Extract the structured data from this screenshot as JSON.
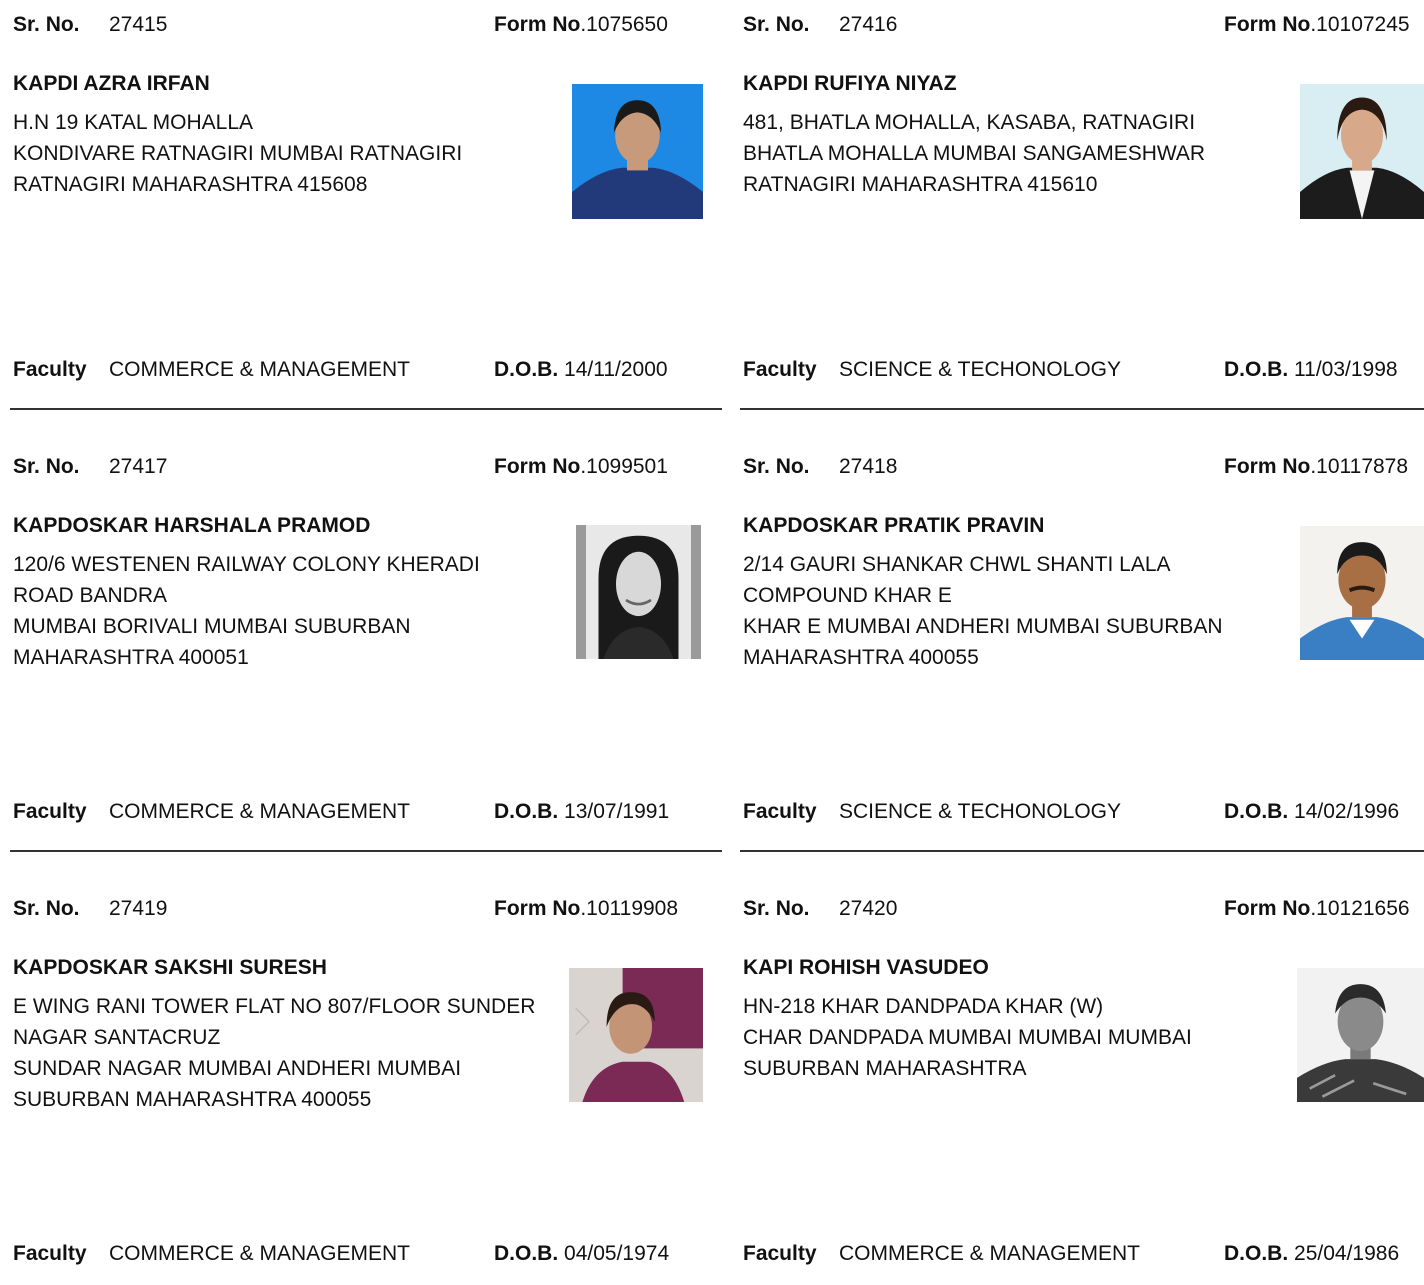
{
  "labels": {
    "sr_no": "Sr. No.",
    "form_no": "Form No",
    "faculty": "Faculty",
    "dob": "D.O.B."
  },
  "records": [
    {
      "sr_no": "27415",
      "form_no": ".1075650",
      "name": "KAPDI AZRA IRFAN",
      "address": [
        "H.N 19 KATAL MOHALLA",
        "KONDIVARE RATNAGIRI MUMBAI RATNAGIRI",
        "RATNAGIRI MAHARASHTRA 415608"
      ],
      "faculty": "COMMERCE & MANAGEMENT",
      "dob": "14/11/2000",
      "photo": {
        "bg": "#1e88e5",
        "clothing": "#233a7a"
      }
    },
    {
      "sr_no": "27416",
      "form_no": ".10107245",
      "name": "KAPDI RUFIYA NIYAZ",
      "address": [
        "481, BHATLA MOHALLA, KASABA, RATNAGIRI",
        "BHATLA MOHALLA MUMBAI SANGAMESHWAR",
        "RATNAGIRI MAHARASHTRA 415610"
      ],
      "faculty": "SCIENCE & TECHONOLOGY",
      "dob": "11/03/1998",
      "photo": {
        "bg": "#d9eef2",
        "clothing": "#1c1c1c"
      }
    },
    {
      "sr_no": "27417",
      "form_no": ".1099501",
      "name": "KAPDOSKAR HARSHALA PRAMOD",
      "address": [
        "120/6 WESTENEN RAILWAY COLONY KHERADI",
        "ROAD BANDRA",
        " MUMBAI BORIVALI MUMBAI SUBURBAN",
        "MAHARASHTRA 400051"
      ],
      "faculty": "COMMERCE & MANAGEMENT",
      "dob": "13/07/1991",
      "photo": {
        "bg": "#9a9a9a",
        "clothing": "#2a2a2a"
      }
    },
    {
      "sr_no": "27418",
      "form_no": ".10117878",
      "name": "KAPDOSKAR PRATIK PRAVIN",
      "address": [
        "2/14 GAURI SHANKAR CHWL SHANTI LALA",
        "COMPOUND KHAR E",
        "KHAR E MUMBAI ANDHERI MUMBAI SUBURBAN",
        "MAHARASHTRA 400055"
      ],
      "faculty": "SCIENCE & TECHONOLOGY",
      "dob": "14/02/1996",
      "photo": {
        "bg": "#f4f2ee",
        "clothing": "#3a7fc4"
      }
    },
    {
      "sr_no": "27419",
      "form_no": ".10119908",
      "name": "KAPDOSKAR SAKSHI SURESH",
      "address": [
        "E WING RANI TOWER FLAT NO 807/FLOOR SUNDER",
        "NAGAR SANTACRUZ",
        "SUNDAR NAGAR MUMBAI ANDHERI MUMBAI",
        "SUBURBAN MAHARASHTRA 400055"
      ],
      "faculty": "COMMERCE & MANAGEMENT",
      "dob": "04/05/1974",
      "photo": {
        "bg": "#d9d4cf",
        "clothing": "#7a2a55"
      }
    },
    {
      "sr_no": "27420",
      "form_no": ".10121656",
      "name": "KAPI ROHISH VASUDEO",
      "address": [
        "HN-218 KHAR DANDPADA KHAR (W)",
        "CHAR DANDPADA MUMBAI MUMBAI MUMBAI",
        "SUBURBAN MAHARASHTRA"
      ],
      "faculty": "COMMERCE & MANAGEMENT",
      "dob": "25/04/1986",
      "photo": {
        "bg": "#f2f2f2",
        "clothing": "#3a3a3a"
      }
    }
  ]
}
